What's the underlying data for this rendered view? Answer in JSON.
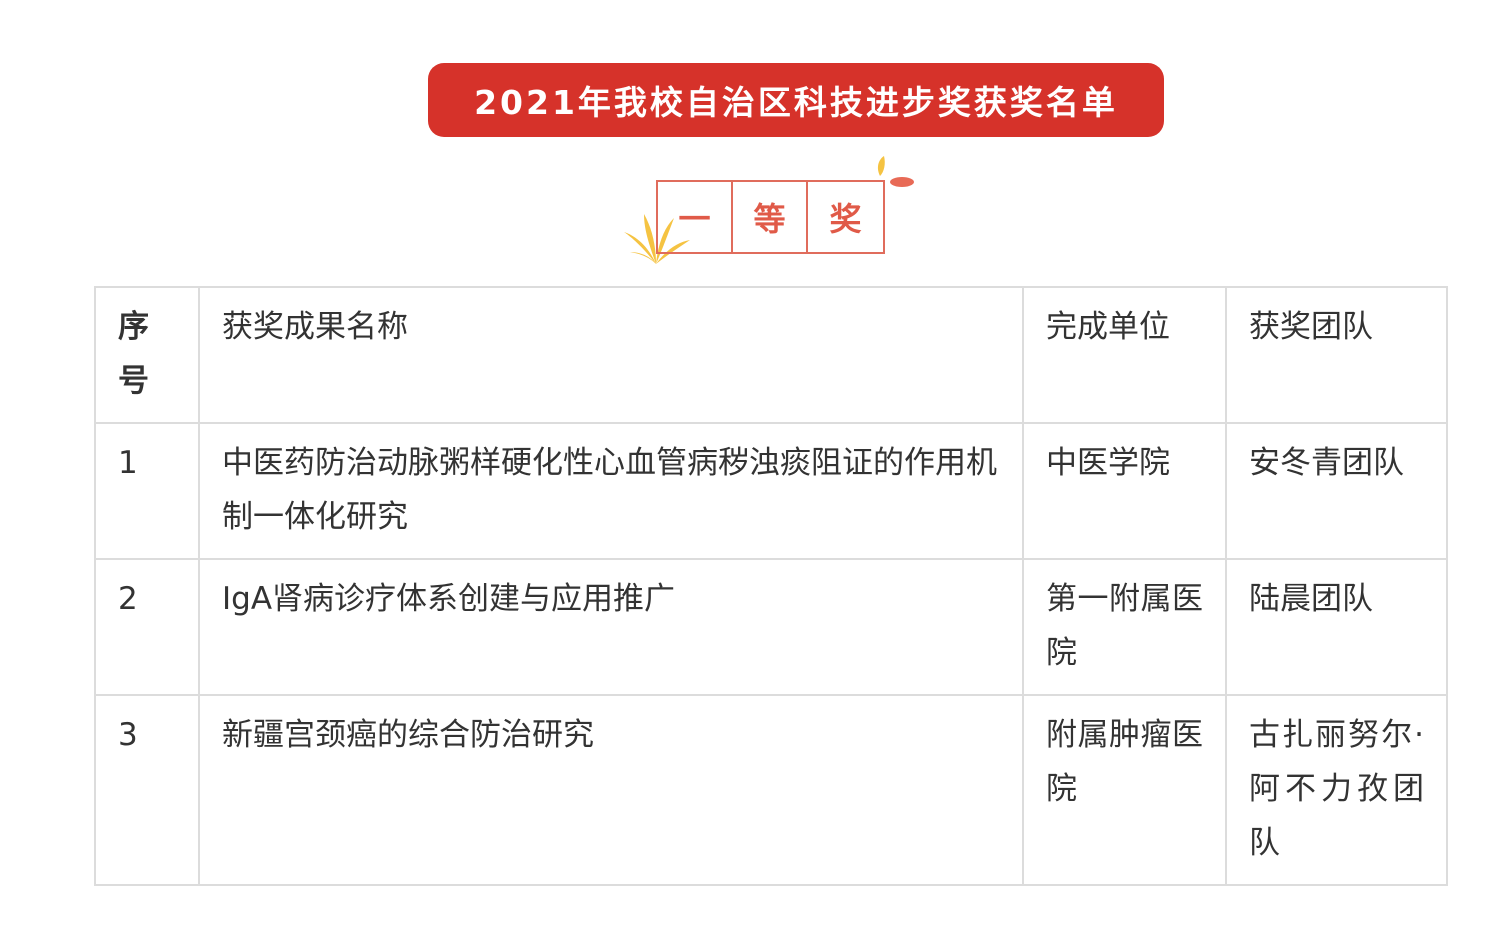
{
  "banner": {
    "title": "2021年我校自治区科技进步奖获奖名单"
  },
  "award_level": {
    "chars": [
      "一",
      "等",
      "奖"
    ]
  },
  "colors": {
    "banner_red": "#d6322a",
    "award_red": "#e05a48",
    "leaf_yellow": "#f5c342",
    "grid": "#dcdcdc"
  },
  "table": {
    "headers": [
      "序号",
      "获奖成果名称",
      "完成单位",
      "获奖团队"
    ],
    "rows": [
      {
        "no": "1",
        "title": "中医药防治动脉粥样硬化性心血管病秽浊痰阻证的作用机制一体化研究",
        "unit": "中医学院",
        "team": "安冬青团队"
      },
      {
        "no": "2",
        "title": "IgA肾病诊疗体系创建与应用推广",
        "unit": "第一附属医院",
        "team": "陆晨团队"
      },
      {
        "no": "3",
        "title": "新疆宫颈癌的综合防治研究",
        "unit": "附属肿瘤医院",
        "team": "古扎丽努尔·阿不力孜团队"
      }
    ]
  }
}
